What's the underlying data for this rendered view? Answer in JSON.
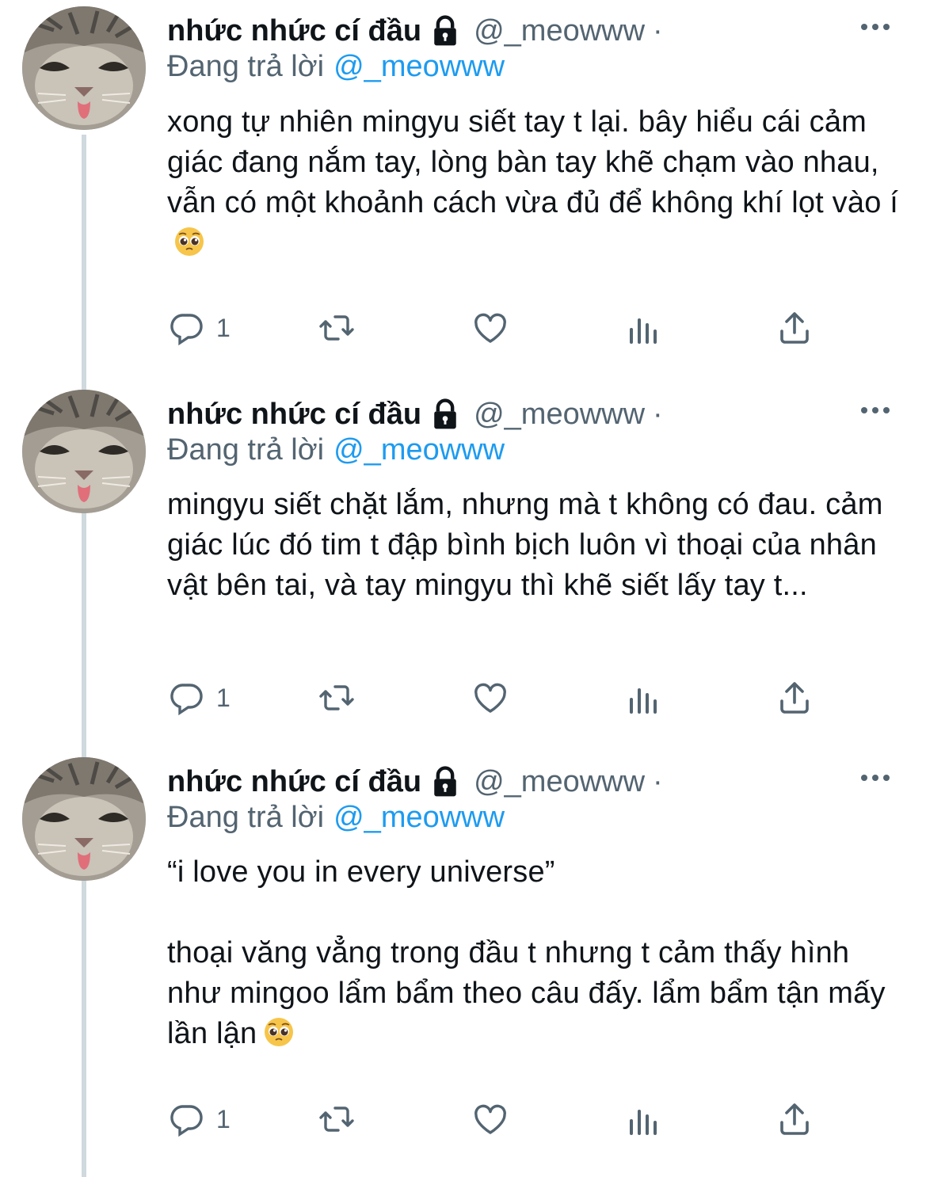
{
  "tweets": [
    {
      "display_name": "nhức nhức cí đầu",
      "handle": "@_meowww",
      "dot": "·",
      "replying_label": "Đang trả lời",
      "replying_to": "@_meowww",
      "text": "xong tự nhiên mingyu siết tay t lại. bây hiểu cái cảm giác đang nắm tay, lòng bàn tay khẽ chạm vào nhau, vẫn có một khoảnh cách vừa đủ để không khí lọt vào í",
      "emoji": "pleading-face",
      "reply_count": "1"
    },
    {
      "display_name": "nhức nhức cí đầu",
      "handle": "@_meowww",
      "dot": "·",
      "replying_label": "Đang trả lời",
      "replying_to": "@_meowww",
      "text": "mingyu siết chặt lắm, nhưng mà t không có đau. cảm giác lúc đó tim t đập bình bịch luôn vì thoại của nhân vật bên tai, và tay mingyu thì khẽ siết lấy tay t...",
      "reply_count": "1"
    },
    {
      "display_name": "nhức nhức cí đầu",
      "handle": "@_meowww",
      "dot": "·",
      "replying_label": "Đang trả lời",
      "replying_to": "@_meowww",
      "text": "“i love you in every universe”\n\nthoại văng vẳng trong đầu t nhưng t cảm thấy hình như mingoo lẩm bẩm theo câu đấy. lẩm bẩm tận mấy lần lận",
      "emoji": "pleading-face",
      "reply_count": "1"
    }
  ],
  "icons": {
    "lock": "lock-icon",
    "more": "more-icon",
    "reply": "reply-icon",
    "retweet": "retweet-icon",
    "like": "like-icon",
    "analytics": "analytics-icon",
    "share": "share-icon",
    "avatar": "cat-avatar"
  },
  "colors": {
    "text": "#0f1419",
    "secondary": "#536471",
    "link": "#1d9bf0",
    "thread_line": "#cfd9de"
  }
}
